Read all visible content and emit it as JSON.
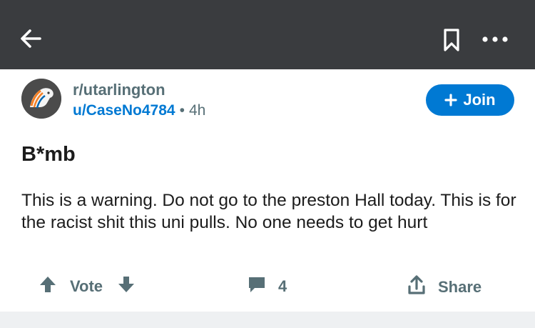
{
  "topbar": {
    "back_icon": "arrow-left-icon",
    "bookmark_icon": "bookmark-icon",
    "more_icon": "more-horizontal-icon"
  },
  "post": {
    "subreddit": "r/utarlington",
    "author": "u/CaseNo4784",
    "separator": "•",
    "time": "4h",
    "join_label": "Join",
    "title": "B*mb",
    "body": "This is a warning. Do not go to the preston Hall today. This is for the racist shit this uni pulls. No one needs to get hurt"
  },
  "actions": {
    "vote_label": "Vote",
    "comments_count": "4",
    "share_label": "Share"
  },
  "colors": {
    "topbar_bg": "#3a3c3f",
    "accent": "#0079d3",
    "muted": "#576f76"
  }
}
